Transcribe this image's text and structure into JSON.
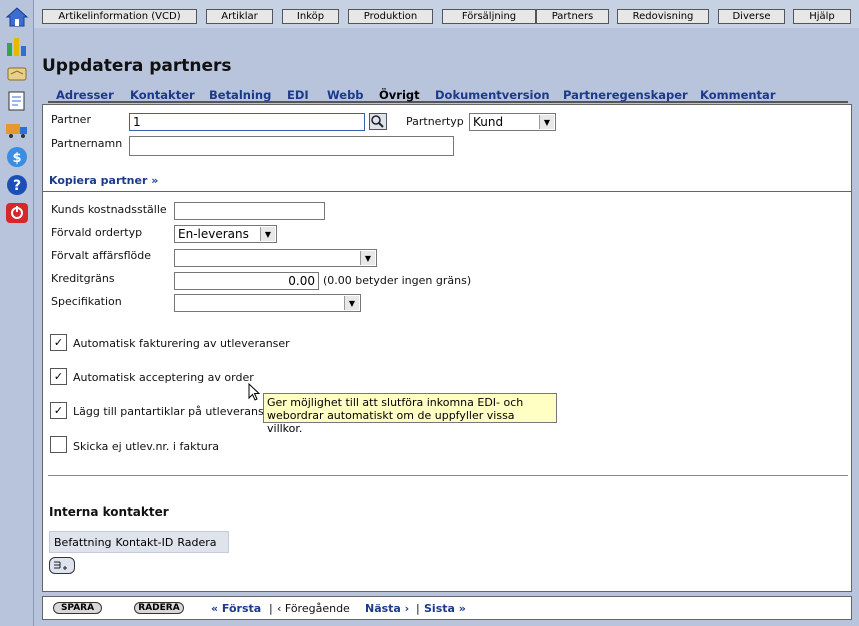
{
  "topnav": [
    "Artikelinformation (VCD)",
    "Artiklar",
    "Inköp",
    "Produktion",
    "Försäljning",
    "Partners",
    "Redovisning",
    "Diverse",
    "Hjälp"
  ],
  "page_title": "Uppdatera partners",
  "tabs": [
    "Adresser",
    "Kontakter",
    "Betalning",
    "EDI",
    "Webb",
    "Övrigt",
    "Dokumentversion",
    "Partneregenskaper",
    "Kommentar"
  ],
  "active_tab": "Övrigt",
  "partner": {
    "partner_label": "Partner",
    "partner_value": "1",
    "partnertyp_label": "Partnertyp",
    "partnertyp_value": "Kund",
    "partnernamn_label": "Partnernamn",
    "partnernamn_value": "",
    "kopiera_link": "Kopiera partner »"
  },
  "settings": {
    "kostnadsstalle_label": "Kunds kostnadsställe",
    "kostnadsstalle_value": "",
    "ordertyp_label": "Förvald ordertyp",
    "ordertyp_value": "En-leverans",
    "affarsflode_label": "Förvalt affärsflöde",
    "affarsflode_value": "",
    "kreditgrans_label": "Kreditgräns",
    "kreditgrans_value": "0.00",
    "kreditgrans_hint": "(0.00 betyder ingen gräns)",
    "specifikation_label": "Specifikation",
    "specifikation_value": ""
  },
  "checkboxes": [
    {
      "label": "Automatisk fakturering av utleveranser",
      "checked": true
    },
    {
      "label": "Automatisk acceptering av order",
      "checked": true
    },
    {
      "label": "Lägg till pantartiklar på utleveranser",
      "checked": true
    },
    {
      "label": "Skicka ej utlev.nr. i faktura",
      "checked": false
    }
  ],
  "tooltip": {
    "line1": "Ger möjlighet till att slutföra inkomna EDI- och",
    "line2": "webordrar automatiskt om de uppfyller vissa villkor."
  },
  "interna": {
    "title": "Interna kontakter",
    "columns": [
      "Befattning",
      "Kontakt-ID",
      "Radera"
    ]
  },
  "footer": {
    "spara": "SPARA",
    "radera": "RADERA",
    "forsta": "« Första",
    "sep1": "|",
    "foregaende": "‹ Föregående",
    "nasta": "Nästa ›",
    "sep2": "|",
    "sista": "Sista »"
  },
  "sidebar_icons": [
    "home-icon",
    "chart-icon",
    "handshake-icon",
    "notes-icon",
    "truck-icon",
    "dollar-icon",
    "help-icon",
    "power-icon"
  ]
}
